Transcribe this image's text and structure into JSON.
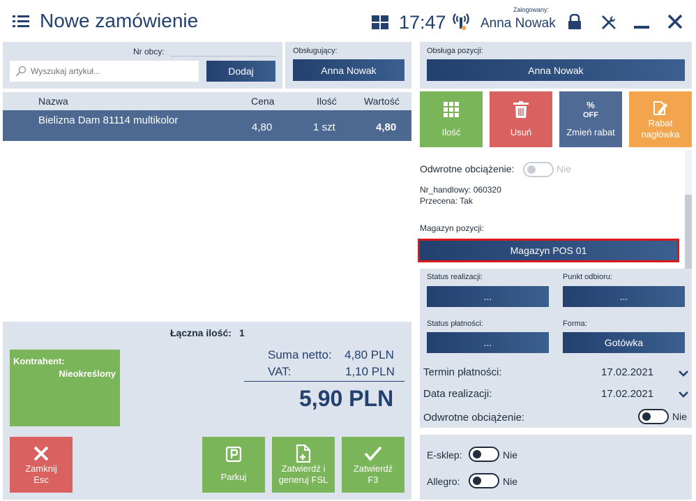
{
  "header": {
    "title": "Nowe zamówienie",
    "time": "17:47",
    "logged_label": "Zalogowany:",
    "user": "Anna Nowak"
  },
  "search": {
    "nr_obcy_label": "Nr obcy:",
    "placeholder": "Wyszukaj artykuł...",
    "add_label": "Dodaj"
  },
  "obslugujacy": {
    "label": "Obsługujący:",
    "value": "Anna Nowak"
  },
  "obsluga_pozycji": {
    "label": "Obsługa pozycji:",
    "value": "Anna Nowak"
  },
  "table": {
    "columns": [
      "Nazwa",
      "Cena",
      "Ilość",
      "Wartość"
    ],
    "rows": [
      {
        "name": "Bielizna Dam 81114 multikolor",
        "price": "4,80",
        "qty": "1 szt",
        "value": "4,80"
      }
    ]
  },
  "total_qty": {
    "label": "Łączna ilość:",
    "value": "1"
  },
  "contractor": {
    "label": "Kontrahent:",
    "value": "Nieokreślony"
  },
  "summary": {
    "netto_label": "Suma netto:",
    "netto_value": "4,80 PLN",
    "vat_label": "VAT:",
    "vat_value": "1,10 PLN",
    "total": "5,90 PLN"
  },
  "bottom_buttons": {
    "close_line1": "Zamknij",
    "close_line2": "Esc",
    "park": "Parkuj",
    "confirm_fsl_line1": "Zatwierdź i",
    "confirm_fsl_line2": "generuj FSL",
    "confirm_line1": "Zatwierdź",
    "confirm_line2": "F3"
  },
  "tiles": {
    "qty": "Ilość",
    "delete": "Usuń",
    "discount": "Zmień rabat",
    "discount_icon_text": "OFF",
    "header_discount_line1": "Rabat",
    "header_discount_line2": "nagłówka"
  },
  "details": {
    "reverse_charge_label": "Odwrotne obciążenie:",
    "reverse_charge_value": "Nie",
    "nr_handlowy": "Nr_handlowy: 060320",
    "przecena": "Przecena: Tak",
    "warehouse_label": "Magazyn pozycji:",
    "warehouse_value": "Magazyn POS 01"
  },
  "order": {
    "status_realizacji_label": "Status realizacji:",
    "status_realizacji_value": "...",
    "punkt_odbioru_label": "Punkt odbioru:",
    "punkt_odbioru_value": "...",
    "status_platnosci_label": "Status płatności:",
    "status_platnosci_value": "...",
    "forma_label": "Forma:",
    "forma_value": "Gotówka",
    "termin_label": "Termin płatności:",
    "termin_value": "17.02.2021",
    "data_real_label": "Data realizacji:",
    "data_real_value": "17.02.2021",
    "reverse_charge_label": "Odwrotne obciążenie:",
    "reverse_charge_value": "Nie"
  },
  "channels": {
    "esklep_label": "E-sklep:",
    "esklep_value": "Nie",
    "allegro_label": "Allegro:",
    "allegro_value": "Nie"
  },
  "colors": {
    "navy": "#23406e",
    "green": "#7bb55a",
    "red": "#d9615f",
    "slate": "#4f6a95",
    "orange": "#f3a54d",
    "panel": "#dde3ec",
    "highlight": "#d8191c"
  }
}
